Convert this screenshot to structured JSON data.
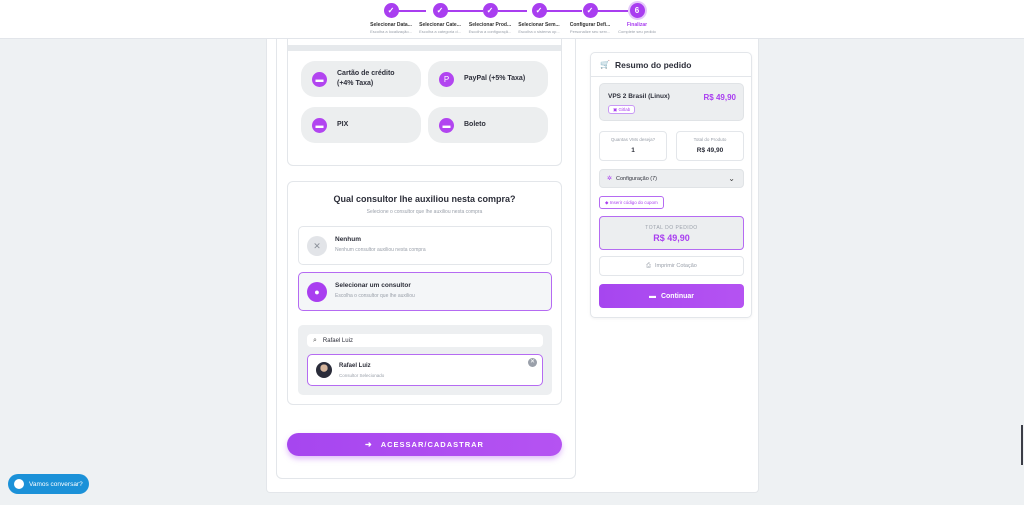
{
  "stepper": {
    "steps": [
      {
        "label": "Selecionar Data...",
        "sub": "Escolha a localização..."
      },
      {
        "label": "Selecionar Cate...",
        "sub": "Escolha a categoria d..."
      },
      {
        "label": "Selecionar Prod...",
        "sub": "Escolha a configuraçã..."
      },
      {
        "label": "Selecionar Sem...",
        "sub": "Escolha o sistema op..."
      },
      {
        "label": "Configurar Defi...",
        "sub": "Personalize seu serv..."
      },
      {
        "label": "Finalizar",
        "sub": "Complete seu pedido",
        "number": "6"
      }
    ],
    "check_icon": "✓"
  },
  "payment": {
    "options": [
      {
        "label": "Cartão de crédito (+4% Taxa)",
        "icon": "card-icon"
      },
      {
        "label": "PayPal (+5% Taxa)",
        "icon": "paypal-icon"
      },
      {
        "label": "PIX",
        "icon": "pix-icon"
      },
      {
        "label": "Boleto",
        "icon": "boleto-icon"
      }
    ]
  },
  "consultant": {
    "title": "Qual consultor lhe auxiliou nesta compra?",
    "subtitle": "Selecione o consultor que lhe auxiliou nesta compra",
    "options": [
      {
        "title": "Nenhum",
        "sub": "Nenhum consultor auxiliou nesta compra"
      },
      {
        "title": "Selecionar um consultor",
        "sub": "Escolha o consultor que lhe auxiliou"
      }
    ],
    "search_value": "Rafael Luiz",
    "selected": {
      "name": "Rafael Luiz",
      "role": "Consultor Selecionado"
    }
  },
  "login_button": "ACESSAR/CADASTRAR",
  "summary": {
    "title": "Resumo do pedido",
    "item_name": "VPS 2 Brasil (Linux)",
    "item_price": "R$ 49,90",
    "item_tag": "Gitlab",
    "qty_label": "Quantas VMs deseja?",
    "qty_value": "1",
    "product_total_label": "Total do Produto",
    "product_total_value": "R$ 49,90",
    "config_label": "Configuração (7)",
    "coupon_label": "Inserir código do cupom",
    "total_label": "TOTAL DO PEDIDO",
    "total_value": "R$ 49,90",
    "print_label": "Imprimir Cotação",
    "continue_label": "Continuar"
  },
  "chat": {
    "label": "Vamos conversar?"
  },
  "colors": {
    "accent": "#a93ef0",
    "chat": "#1b91d8"
  }
}
